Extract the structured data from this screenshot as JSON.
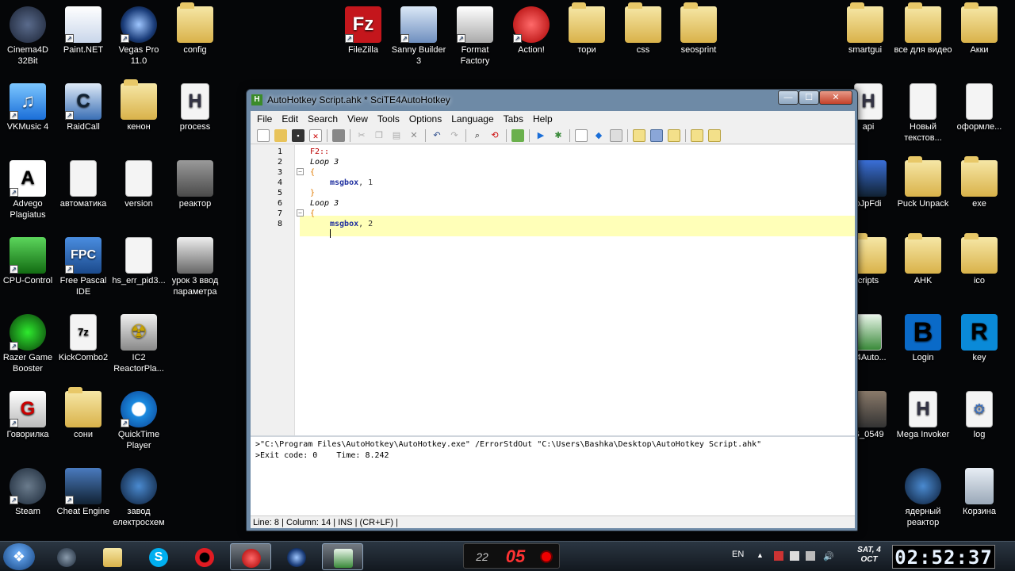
{
  "desktop_icons": {
    "cinema4d": "Cinema4D 32Bit",
    "paintnet": "Paint.NET",
    "vegas": "Vegas Pro 11.0",
    "config": "config",
    "filezilla": "FileZilla",
    "sanny": "Sanny Builder 3",
    "format_factory": "Format Factory",
    "action": "Action!",
    "tori": "тори",
    "css": "css",
    "seosprint": "seosprint",
    "smartgui": "smartgui",
    "vse_dlya_video": "все для видео",
    "akki": "Акки",
    "vkmusic": "VKMusic 4",
    "raidcall": "RaidCall",
    "kenon": "кенон",
    "process": "process",
    "api": "api",
    "novyi_tekst": "Новый текстов...",
    "oformle": "оформле...",
    "advego": "Advego Plagiatus",
    "avtomatika": "автоматика",
    "version": "version",
    "reaktor": "реактор",
    "jpfdi": "oJpFdi",
    "puck_unpack": "Puck Unpack",
    "exe": "exe",
    "cpu_control": "CPU-Control",
    "free_pascal": "Free Pascal IDE",
    "hs_err": "hs_err_pid3...",
    "urok3": "урок 3 ввод параметра",
    "scripts": "cripts",
    "ahk": "AHK",
    "ico": "ico",
    "razer": "Razer Game Booster",
    "kickcombo": "KickCombo2",
    "ic2": "IC2 ReactorPla...",
    "e4auto": "E4Auto...",
    "login": "Login",
    "key": "key",
    "govorilka": "Говорилка",
    "soni": "сони",
    "quicktime": "QuickTime Player",
    "g0549": "G_0549",
    "mega_invoker": "Mega Invoker",
    "log": "log",
    "steam": "Steam",
    "cheat_engine": "Cheat Engine",
    "zavod": "завод електросхем",
    "yadernyi": "ядерный реактор",
    "korzina": "Корзина"
  },
  "window": {
    "title": "AutoHotkey Script.ahk * SciTE4AutoHotkey",
    "min": "—",
    "max": "☐",
    "close": "✕"
  },
  "menu": [
    "File",
    "Edit",
    "Search",
    "View",
    "Tools",
    "Options",
    "Language",
    "Tabs",
    "Help"
  ],
  "code_lines": [
    {
      "num": "1",
      "text": "F2::"
    },
    {
      "num": "2",
      "text": "Loop 3"
    },
    {
      "num": "3",
      "text": "{"
    },
    {
      "num": "4",
      "cmd": "msgbox",
      "arg": ", 1"
    },
    {
      "num": "5",
      "text": "}"
    },
    {
      "num": "6",
      "text": "Loop 3"
    },
    {
      "num": "7",
      "text": "{"
    },
    {
      "num": "8",
      "cmd": "msgbox",
      "arg": ", 2"
    }
  ],
  "output": {
    "line1": ">\"C:\\Program Files\\AutoHotkey\\AutoHotkey.exe\" /ErrorStdOut \"C:\\Users\\Bashka\\Desktop\\AutoHotkey Script.ahk\"",
    "line2": ">Exit code: 0    Time: 8.242"
  },
  "status": "Line: 8 | Column: 14 | INS | (CR+LF) |",
  "taskbar": {
    "lang": "EN",
    "date_day": "SAT, 4",
    "date_month": "OCT",
    "clock": "02:52:37",
    "rec_small": "22",
    "rec_big": "05"
  }
}
